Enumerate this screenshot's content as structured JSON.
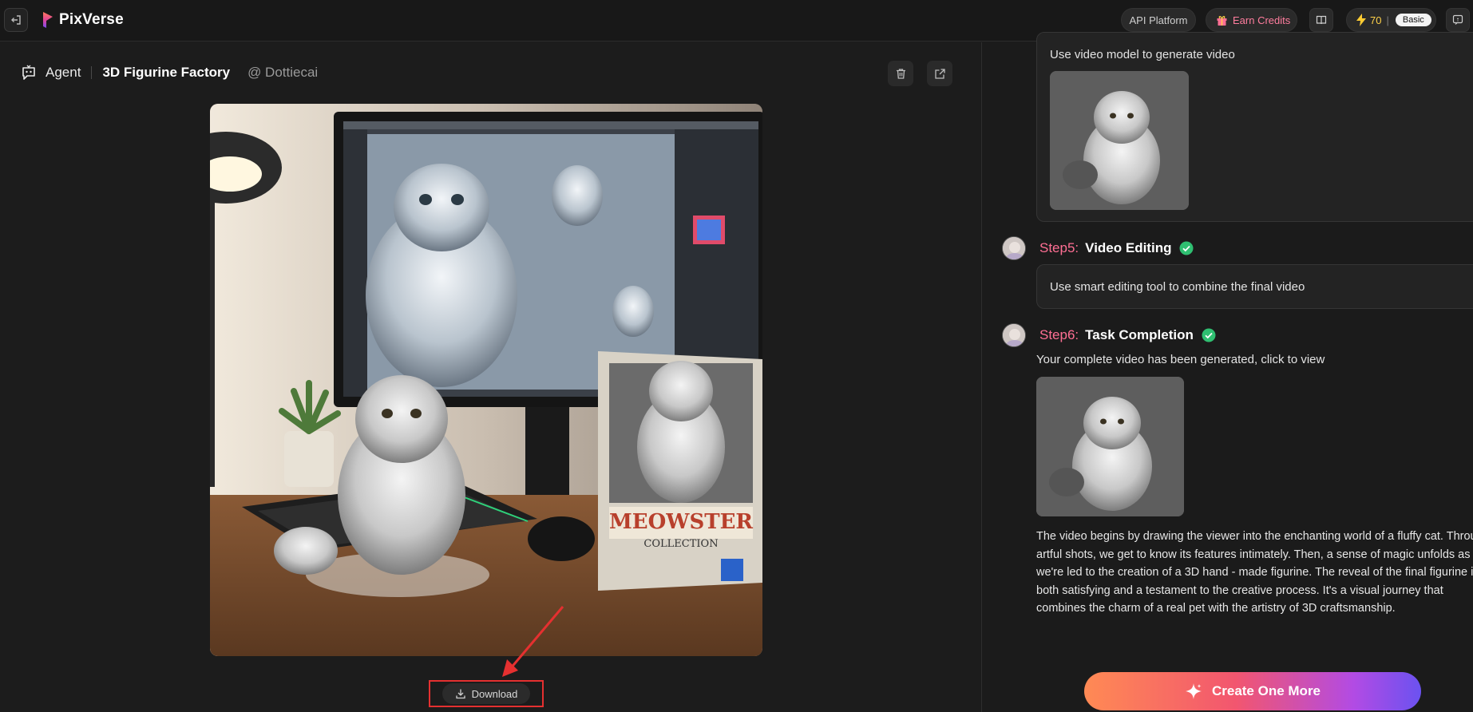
{
  "app": {
    "name": "PixVerse"
  },
  "topbar": {
    "api_platform_label": "API Platform",
    "earn_credits_label": "Earn Credits",
    "credits_value": "70",
    "credits_separator": "|",
    "plan_label": "Basic",
    "accent_color": "#ff6f94"
  },
  "breadcrumb": {
    "agent_label": "Agent",
    "title": "3D Figurine Factory",
    "author": "@ Dottiecai"
  },
  "preview": {
    "download_label": "Download"
  },
  "steps": {
    "step4_text": "Use video model to generate video",
    "step5": {
      "label": "Step5:",
      "name": "Video Editing",
      "text": "Use smart editing tool to combine the final video"
    },
    "step6": {
      "label": "Step6:",
      "name": "Task Completion",
      "text": "Your complete video has been generated, click to view",
      "description_lines": [
        "The video begins by drawing the viewer into the enchanting world of a fluffy cat. Through",
        "artful shots, we get to know its features intimately. Then, a sense of magic unfolds as",
        "we're led to the creation of a 3D hand - made figurine. The reveal of the final figurine is",
        "both satisfying and a testament to the creative process. It's a visual journey that",
        "combines the charm of a real pet with the artistry of 3D craftsmanship."
      ]
    }
  },
  "actions": {
    "create_label": "Create One More"
  }
}
